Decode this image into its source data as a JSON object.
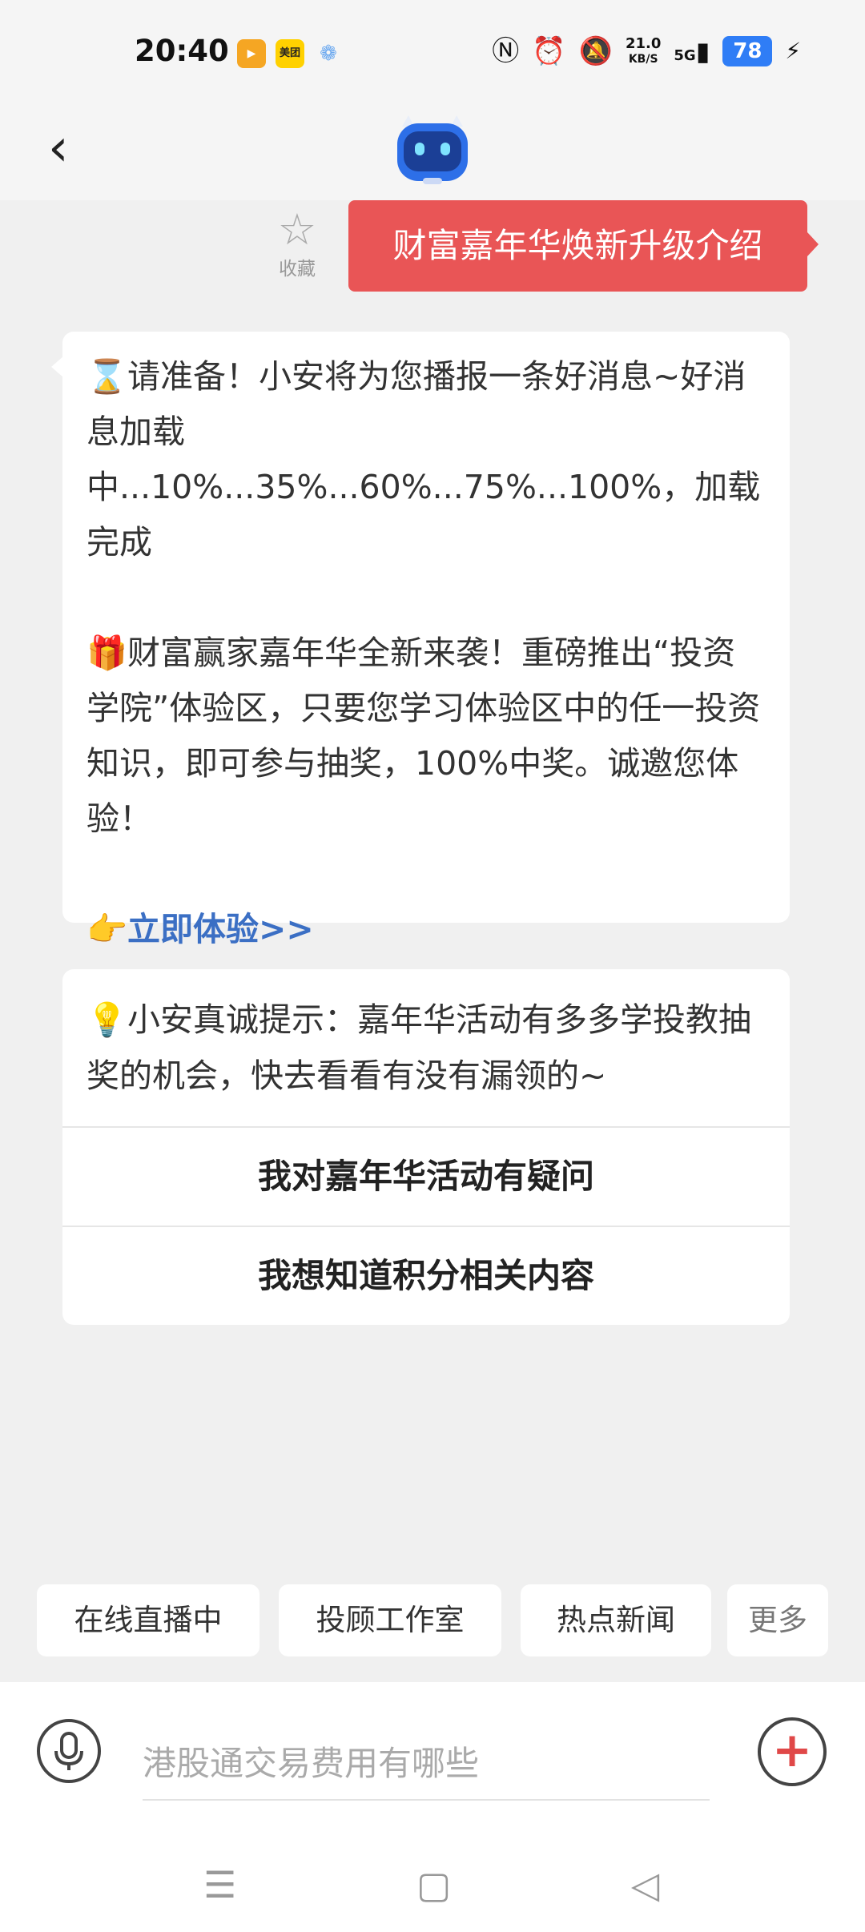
{
  "status_bar": {
    "time": "20:40",
    "app_icons": [
      {
        "name": "video-app-icon",
        "color": "#f5a623"
      },
      {
        "name": "meituan-icon",
        "label": "美团",
        "color": "#ffd100"
      },
      {
        "name": "cloud-app-icon",
        "color": "#6aa8f0"
      }
    ],
    "net_speed": "21.0",
    "net_unit": "KB/S",
    "signal": "5G",
    "battery": "78"
  },
  "header": {
    "back_icon": "chevron-left-icon",
    "avatar_icon": "robot-assistant-icon"
  },
  "banner": {
    "favorite_label": "收藏",
    "title": "财富嘉年华焕新升级介绍",
    "color": "#e95556"
  },
  "message": {
    "line1": "⌛请准备！小安将为您播报一条好消息~好消息加载中...10%...35%...60%...75%...100%，加载完成",
    "line2": "🎁财富赢家嘉年华全新来袭！重磅推出“投资学院”体验区，只要您学习体验区中的任一投资知识，即可参与抽奖，100%中奖。诚邀您体验！",
    "cta": "👉立即体验>>",
    "cta_color": "#3b6fc4"
  },
  "tip_card": {
    "tip": "💡小安真诚提示：嘉年华活动有多多学投教抽奖的机会，快去看看有没有漏领的~",
    "options": [
      "我对嘉年华活动有疑问",
      "我想知道积分相关内容"
    ]
  },
  "quick_tabs": [
    "在线直播中",
    "投顾工作室",
    "热点新闻",
    "更多"
  ],
  "input": {
    "placeholder": "港股通交易费用有哪些"
  },
  "nav": {
    "menu_icon": "☰",
    "home_icon": "▢",
    "back_icon": "◁"
  }
}
